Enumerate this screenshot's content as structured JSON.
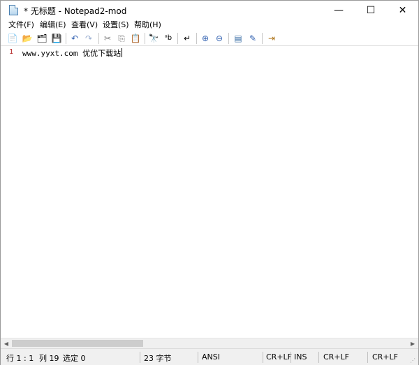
{
  "window": {
    "title": "* 无标题 - Notepad2-mod",
    "controls": {
      "minimize": "—",
      "maximize": "☐",
      "close": "✕"
    }
  },
  "menu": [
    {
      "label": "文件(F)"
    },
    {
      "label": "编辑(E)"
    },
    {
      "label": "查看(V)"
    },
    {
      "label": "设置(S)"
    },
    {
      "label": "帮助(H)"
    }
  ],
  "toolbar": {
    "icons": {
      "new": "📄",
      "open": "📂",
      "browse": "🗂",
      "save": "💾",
      "undo": "↶",
      "redo": "↷",
      "cut": "✂",
      "copy": "⎘",
      "paste": "📋",
      "find": "🔭",
      "replace": "ᵃb",
      "wrap": "↵",
      "zoom_in": "⊕",
      "zoom_out": "⊖",
      "scheme": "▤",
      "customize": "✎",
      "exit": "⇥"
    }
  },
  "editor": {
    "lines": [
      {
        "number": "1",
        "text": "www.yyxt.com 优优下载站"
      }
    ],
    "line_number_color": "#b01c1c"
  },
  "scrollbar": {
    "left_arrow": "◀",
    "right_arrow": "▶"
  },
  "status": {
    "position": "行 1 : 1",
    "column": "列 19",
    "selection": "选定 0",
    "size": "23 字节",
    "encoding": "ANSI",
    "eol": "CR+LF",
    "ins": "INS",
    "eol2": "CR+LF",
    "eol3": "CR+LF",
    "grip": "⋰"
  }
}
